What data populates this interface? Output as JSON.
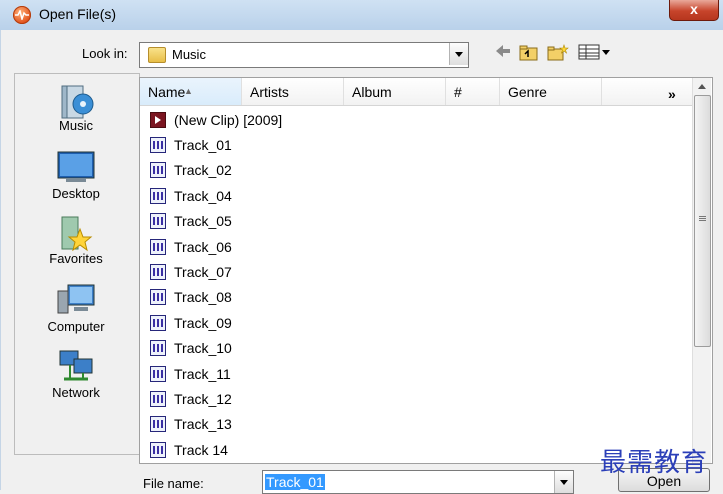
{
  "window": {
    "title": "Open File(s)",
    "close_label": "x"
  },
  "toolbar": {
    "look_in_label": "Look in:",
    "look_in_value": "Music"
  },
  "sidebar": {
    "places": [
      {
        "label": "Music",
        "icon": "music-library-icon"
      },
      {
        "label": "Desktop",
        "icon": "desktop-icon"
      },
      {
        "label": "Favorites",
        "icon": "favorites-star-icon"
      },
      {
        "label": "Computer",
        "icon": "computer-icon"
      },
      {
        "label": "Network",
        "icon": "network-icon"
      }
    ]
  },
  "columns": [
    "Name",
    "Artists",
    "Album",
    "#",
    "Genre"
  ],
  "more_columns": "»",
  "files": [
    {
      "name": "(New Clip) [2009]",
      "type": "clip"
    },
    {
      "name": "Track_01",
      "type": "audio"
    },
    {
      "name": "Track_02",
      "type": "audio"
    },
    {
      "name": "Track_04",
      "type": "audio"
    },
    {
      "name": "Track_05",
      "type": "audio"
    },
    {
      "name": "Track_06",
      "type": "audio"
    },
    {
      "name": "Track_07",
      "type": "audio"
    },
    {
      "name": "Track_08",
      "type": "audio"
    },
    {
      "name": "Track_09",
      "type": "audio"
    },
    {
      "name": "Track_10",
      "type": "audio"
    },
    {
      "name": "Track_11",
      "type": "audio"
    },
    {
      "name": "Track_12",
      "type": "audio"
    },
    {
      "name": "Track_13",
      "type": "audio"
    },
    {
      "name": "Track 14",
      "type": "audio"
    }
  ],
  "footer": {
    "file_name_label": "File name:",
    "file_name_value": "Track_01",
    "open_label": "Open"
  },
  "watermark": "最需教育",
  "colors": {
    "accent": "#3399ff",
    "titlebar": "#b9d1ea",
    "close": "#c7442b"
  }
}
